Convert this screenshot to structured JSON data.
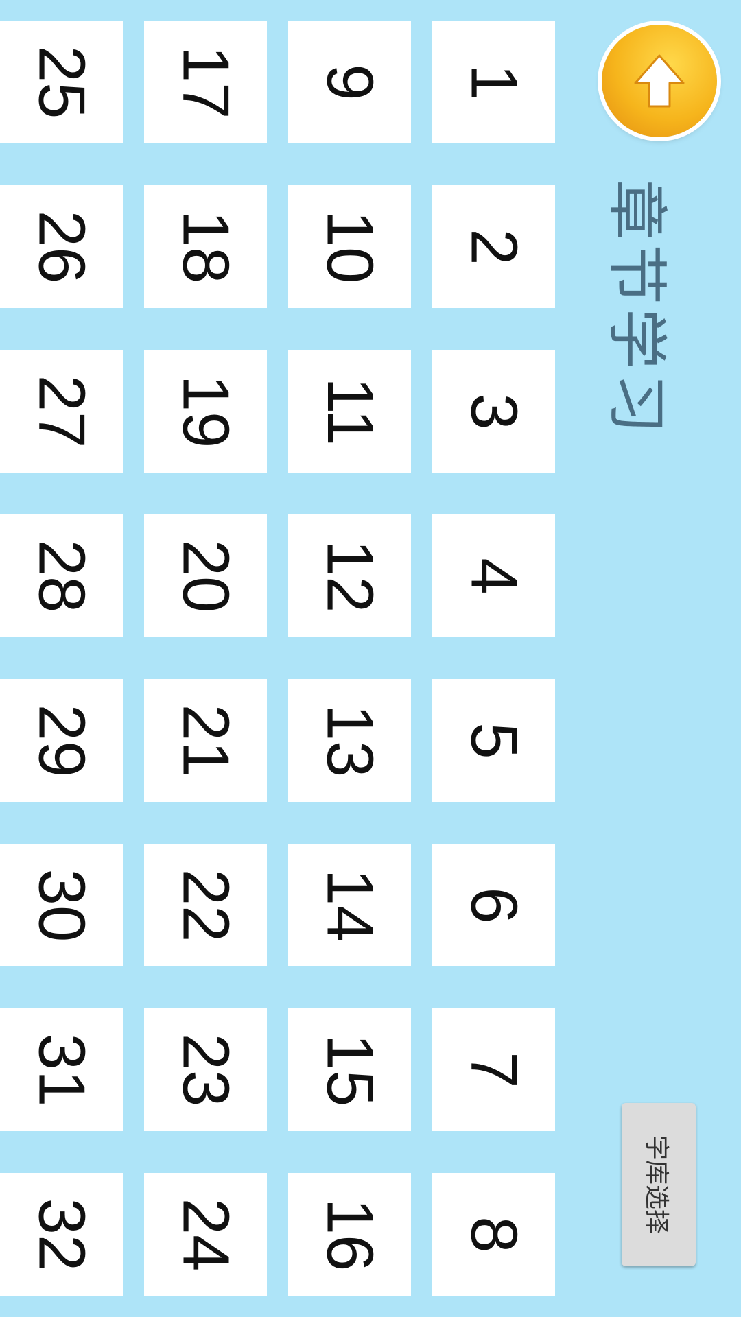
{
  "header": {
    "title": "章节学习",
    "back_icon": "up-arrow-icon"
  },
  "library_button_label": "字库选择",
  "chapters": [
    [
      "1",
      "2",
      "3",
      "4",
      "5",
      "6",
      "7",
      "8"
    ],
    [
      "9",
      "10",
      "11",
      "12",
      "13",
      "14",
      "15",
      "16"
    ],
    [
      "17",
      "18",
      "19",
      "20",
      "21",
      "22",
      "23",
      "24"
    ],
    [
      "25",
      "26",
      "27",
      "28",
      "29",
      "30",
      "31",
      "32"
    ]
  ],
  "colors": {
    "background": "#aee4f8",
    "tile": "#ffffff",
    "title": "#4a6e84",
    "back_button": "#f6b51c"
  }
}
